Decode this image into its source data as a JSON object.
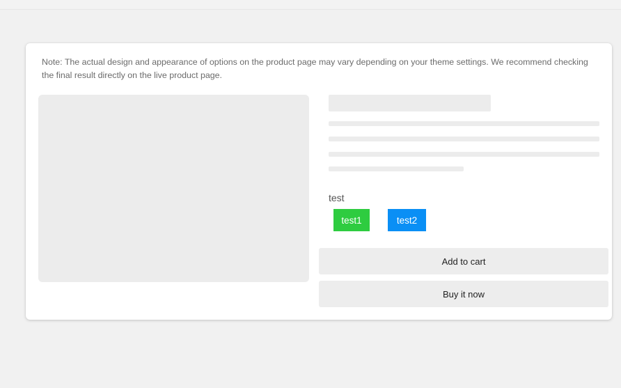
{
  "note": {
    "text": "Note: The actual design and appearance of options on the product page may vary depending on your theme settings. We recommend checking the final result directly on the live product page."
  },
  "option": {
    "label": "test",
    "values": [
      {
        "label": "test1",
        "color": "#2ecc40"
      },
      {
        "label": "test2",
        "color": "#0a8ff5"
      }
    ]
  },
  "actions": {
    "add_to_cart": "Add to cart",
    "buy_now": "Buy it now"
  }
}
